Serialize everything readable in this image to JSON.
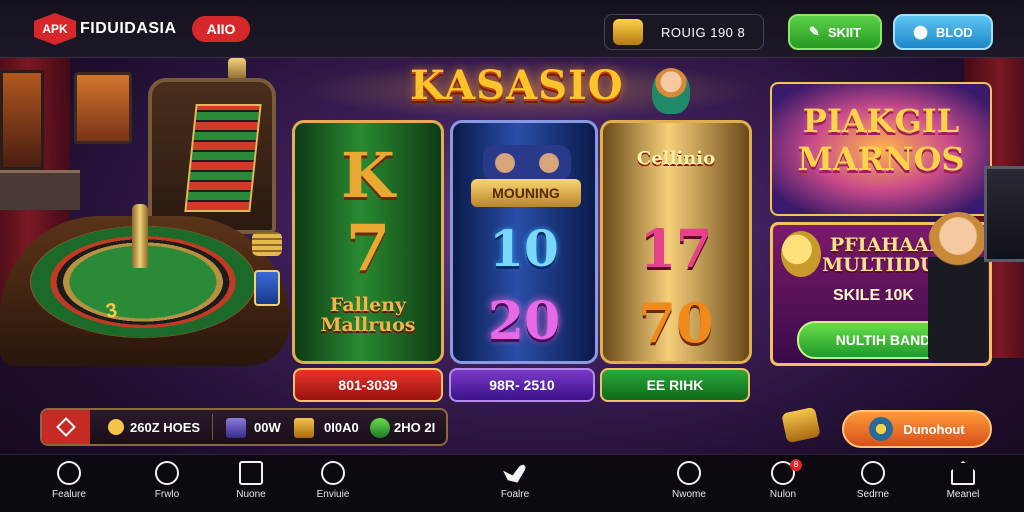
{
  "header": {
    "logo_text": "APK",
    "brand_name": "FIDUIDASIA",
    "brand_badge": "AIIO",
    "wallet_text": "ROUIG 190 8",
    "btn_green_label": "SKIIT",
    "btn_blue_label": "BLOD"
  },
  "main": {
    "game_title": "KASASIO",
    "reels": [
      {
        "symbols": [
          "K",
          "7",
          "Falleny Mallruos"
        ],
        "bar_label": "801-3039"
      },
      {
        "banner": "MOUNING",
        "symbols": [
          "10",
          "20"
        ],
        "bar_label": "98R- 2510"
      },
      {
        "symbols": [
          "Cellinio",
          "17",
          "70"
        ],
        "bar_label": "EE RIHK"
      }
    ],
    "table_mark": "3"
  },
  "promos": {
    "promo1_title": "PIAKGIL MARNOS",
    "promo2_title": "PFIAHAAN MULTIIDUN",
    "promo2_sub": "SKILE 10K",
    "promo2_button": "NULTIH BAND"
  },
  "info_bar": {
    "coins": "260Z HOES",
    "item2": "00W",
    "item3": "0I0A0",
    "item4": "2HO 2I"
  },
  "deposit": {
    "label": "Dunohout"
  },
  "nav": [
    {
      "icon": "chat-icon",
      "label": "Fealure"
    },
    {
      "icon": "search-icon",
      "label": "Frwlo"
    },
    {
      "icon": "box-icon",
      "label": "Nuone"
    },
    {
      "icon": "refresh-icon",
      "label": "Enviuie"
    },
    {
      "icon": "bird-icon",
      "label": "Foalre"
    },
    {
      "icon": "clock-icon",
      "label": "Nwome"
    },
    {
      "icon": "message-icon",
      "label": "Nulon",
      "badge": "8"
    },
    {
      "icon": "timer-icon",
      "label": "Sedrne"
    },
    {
      "icon": "home-icon",
      "label": "Meanel"
    }
  ],
  "colors": {
    "accent_red": "#d6282a",
    "gold": "#ffc42a",
    "green": "#2aa83a",
    "blue": "#1d87c9",
    "orange": "#f08a1a"
  }
}
